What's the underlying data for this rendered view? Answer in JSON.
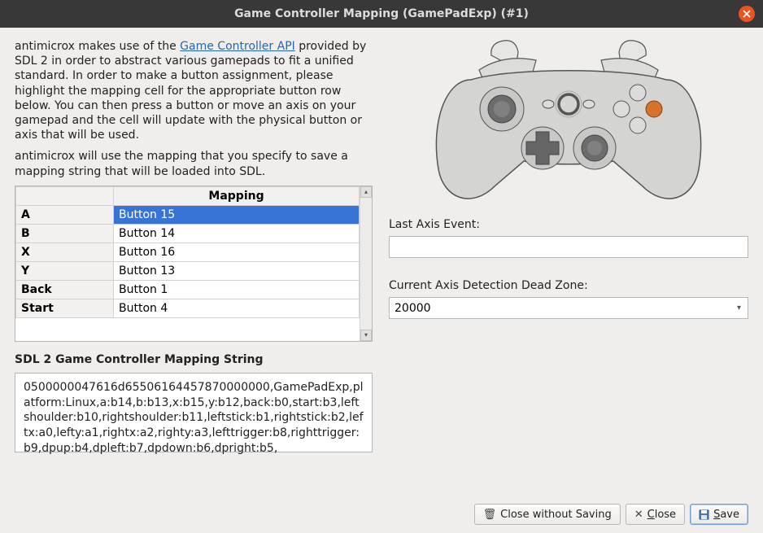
{
  "window": {
    "title": "Game Controller Mapping (GamePadExp) (#1)"
  },
  "intro": {
    "part1": "antimicrox makes use of the ",
    "link": "Game Controller API",
    "part2": " provided by SDL 2 in order to abstract various gamepads to fit a unified standard. In order to make a button assignment, please highlight the mapping cell for the appropriate button row below. You can then press a button or move an axis on your gamepad and the cell will update with the physical button or axis that will be used.",
    "para2": "antimicrox will use the mapping that you specify to save a mapping string that will be loaded into SDL."
  },
  "table": {
    "header": "Mapping",
    "rows": [
      {
        "key": "A",
        "value": "Button 15",
        "selected": true
      },
      {
        "key": "B",
        "value": "Button 14",
        "selected": false
      },
      {
        "key": "X",
        "value": "Button 16",
        "selected": false
      },
      {
        "key": "Y",
        "value": "Button 13",
        "selected": false
      },
      {
        "key": "Back",
        "value": "Button 1",
        "selected": false
      },
      {
        "key": "Start",
        "value": "Button 4",
        "selected": false
      }
    ]
  },
  "sdl": {
    "label": "SDL 2 Game Controller Mapping String",
    "value": "0500000047616d65506164457870000000,GamePadExp,platform:Linux,a:b14,b:b13,x:b15,y:b12,back:b0,start:b3,leftshoulder:b10,rightshoulder:b11,leftstick:b1,rightstick:b2,leftx:a0,lefty:a1,rightx:a2,righty:a3,lefttrigger:b8,righttrigger:b9,dpup:b4,dpleft:b7,dpdown:b6,dpright:b5,"
  },
  "right": {
    "last_axis_label": "Last Axis Event:",
    "last_axis_value": "",
    "deadzone_label": "Current Axis Detection Dead Zone:",
    "deadzone_value": "20000"
  },
  "footer": {
    "close_no_save": "Close without Saving",
    "close": "Close",
    "save": "Save"
  }
}
